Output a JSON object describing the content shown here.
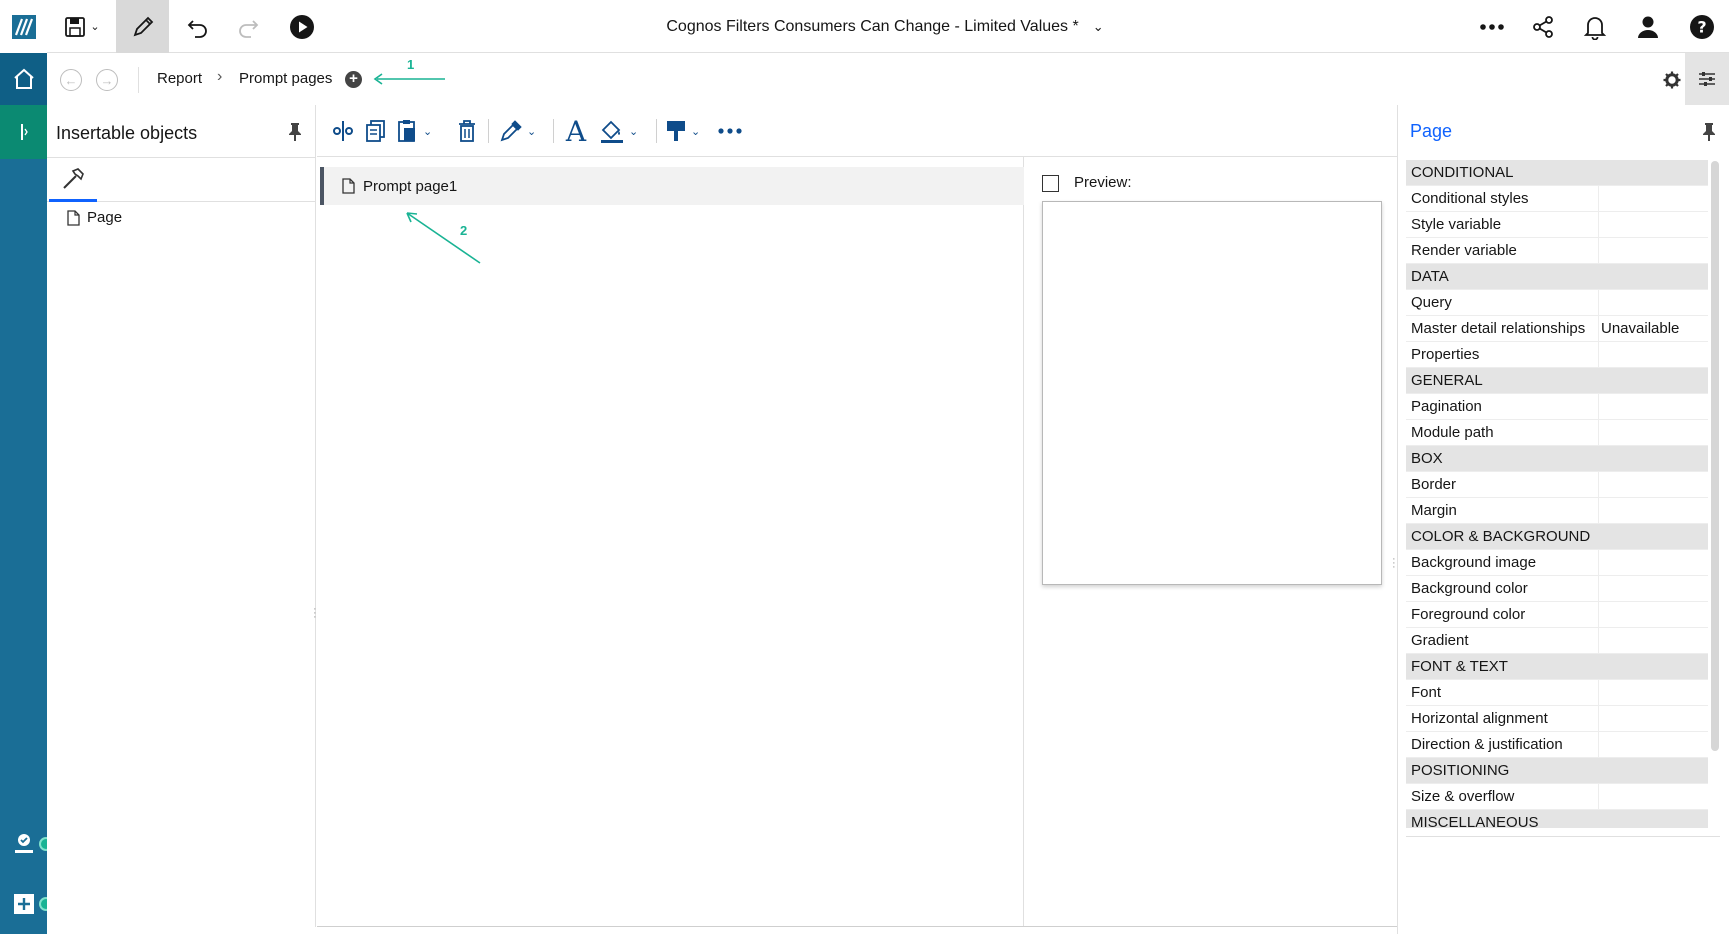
{
  "header": {
    "title": "Cognos Filters Consumers Can Change - Limited Values *"
  },
  "breadcrumb": {
    "items": [
      "Report",
      "Prompt pages"
    ]
  },
  "annotations": {
    "one": "1",
    "two": "2"
  },
  "insertable_objects": {
    "title": "Insertable objects",
    "items": [
      {
        "label": "Page",
        "icon": "page-icon"
      }
    ]
  },
  "canvas": {
    "prompt_pages": [
      {
        "label": "Prompt page1",
        "selected": true
      }
    ],
    "preview_label": "Preview:",
    "preview_checked": false
  },
  "properties": {
    "title": "Page",
    "rows": [
      {
        "name": "CONDITIONAL",
        "section": true,
        "value": ""
      },
      {
        "name": "Conditional styles",
        "section": false,
        "value": ""
      },
      {
        "name": "Style variable",
        "section": false,
        "value": ""
      },
      {
        "name": "Render variable",
        "section": false,
        "value": ""
      },
      {
        "name": "DATA",
        "section": true,
        "value": ""
      },
      {
        "name": "Query",
        "section": false,
        "value": ""
      },
      {
        "name": "Master detail relationships",
        "section": false,
        "value": "Unavailable"
      },
      {
        "name": "Properties",
        "section": false,
        "value": ""
      },
      {
        "name": "GENERAL",
        "section": true,
        "value": ""
      },
      {
        "name": "Pagination",
        "section": false,
        "value": ""
      },
      {
        "name": "Module path",
        "section": false,
        "value": ""
      },
      {
        "name": "BOX",
        "section": true,
        "value": ""
      },
      {
        "name": "Border",
        "section": false,
        "value": ""
      },
      {
        "name": "Margin",
        "section": false,
        "value": ""
      },
      {
        "name": "COLOR & BACKGROUND",
        "section": true,
        "value": ""
      },
      {
        "name": "Background image",
        "section": false,
        "value": ""
      },
      {
        "name": "Background color",
        "section": false,
        "value": ""
      },
      {
        "name": "Foreground color",
        "section": false,
        "value": ""
      },
      {
        "name": "Gradient",
        "section": false,
        "value": ""
      },
      {
        "name": "FONT & TEXT",
        "section": true,
        "value": ""
      },
      {
        "name": "Font",
        "section": false,
        "value": ""
      },
      {
        "name": "Horizontal alignment",
        "section": false,
        "value": ""
      },
      {
        "name": "Direction & justification",
        "section": false,
        "value": ""
      },
      {
        "name": "POSITIONING",
        "section": true,
        "value": ""
      },
      {
        "name": "Size & overflow",
        "section": false,
        "value": ""
      },
      {
        "name": "MISCELLANEOUS",
        "section": true,
        "value": ""
      }
    ]
  },
  "colors": {
    "rail": "#1a6e96",
    "rail_active": "#0b8a72",
    "accent": "#0f62fe",
    "annotation": "#19b394",
    "section_bg": "#e4e4e4"
  }
}
